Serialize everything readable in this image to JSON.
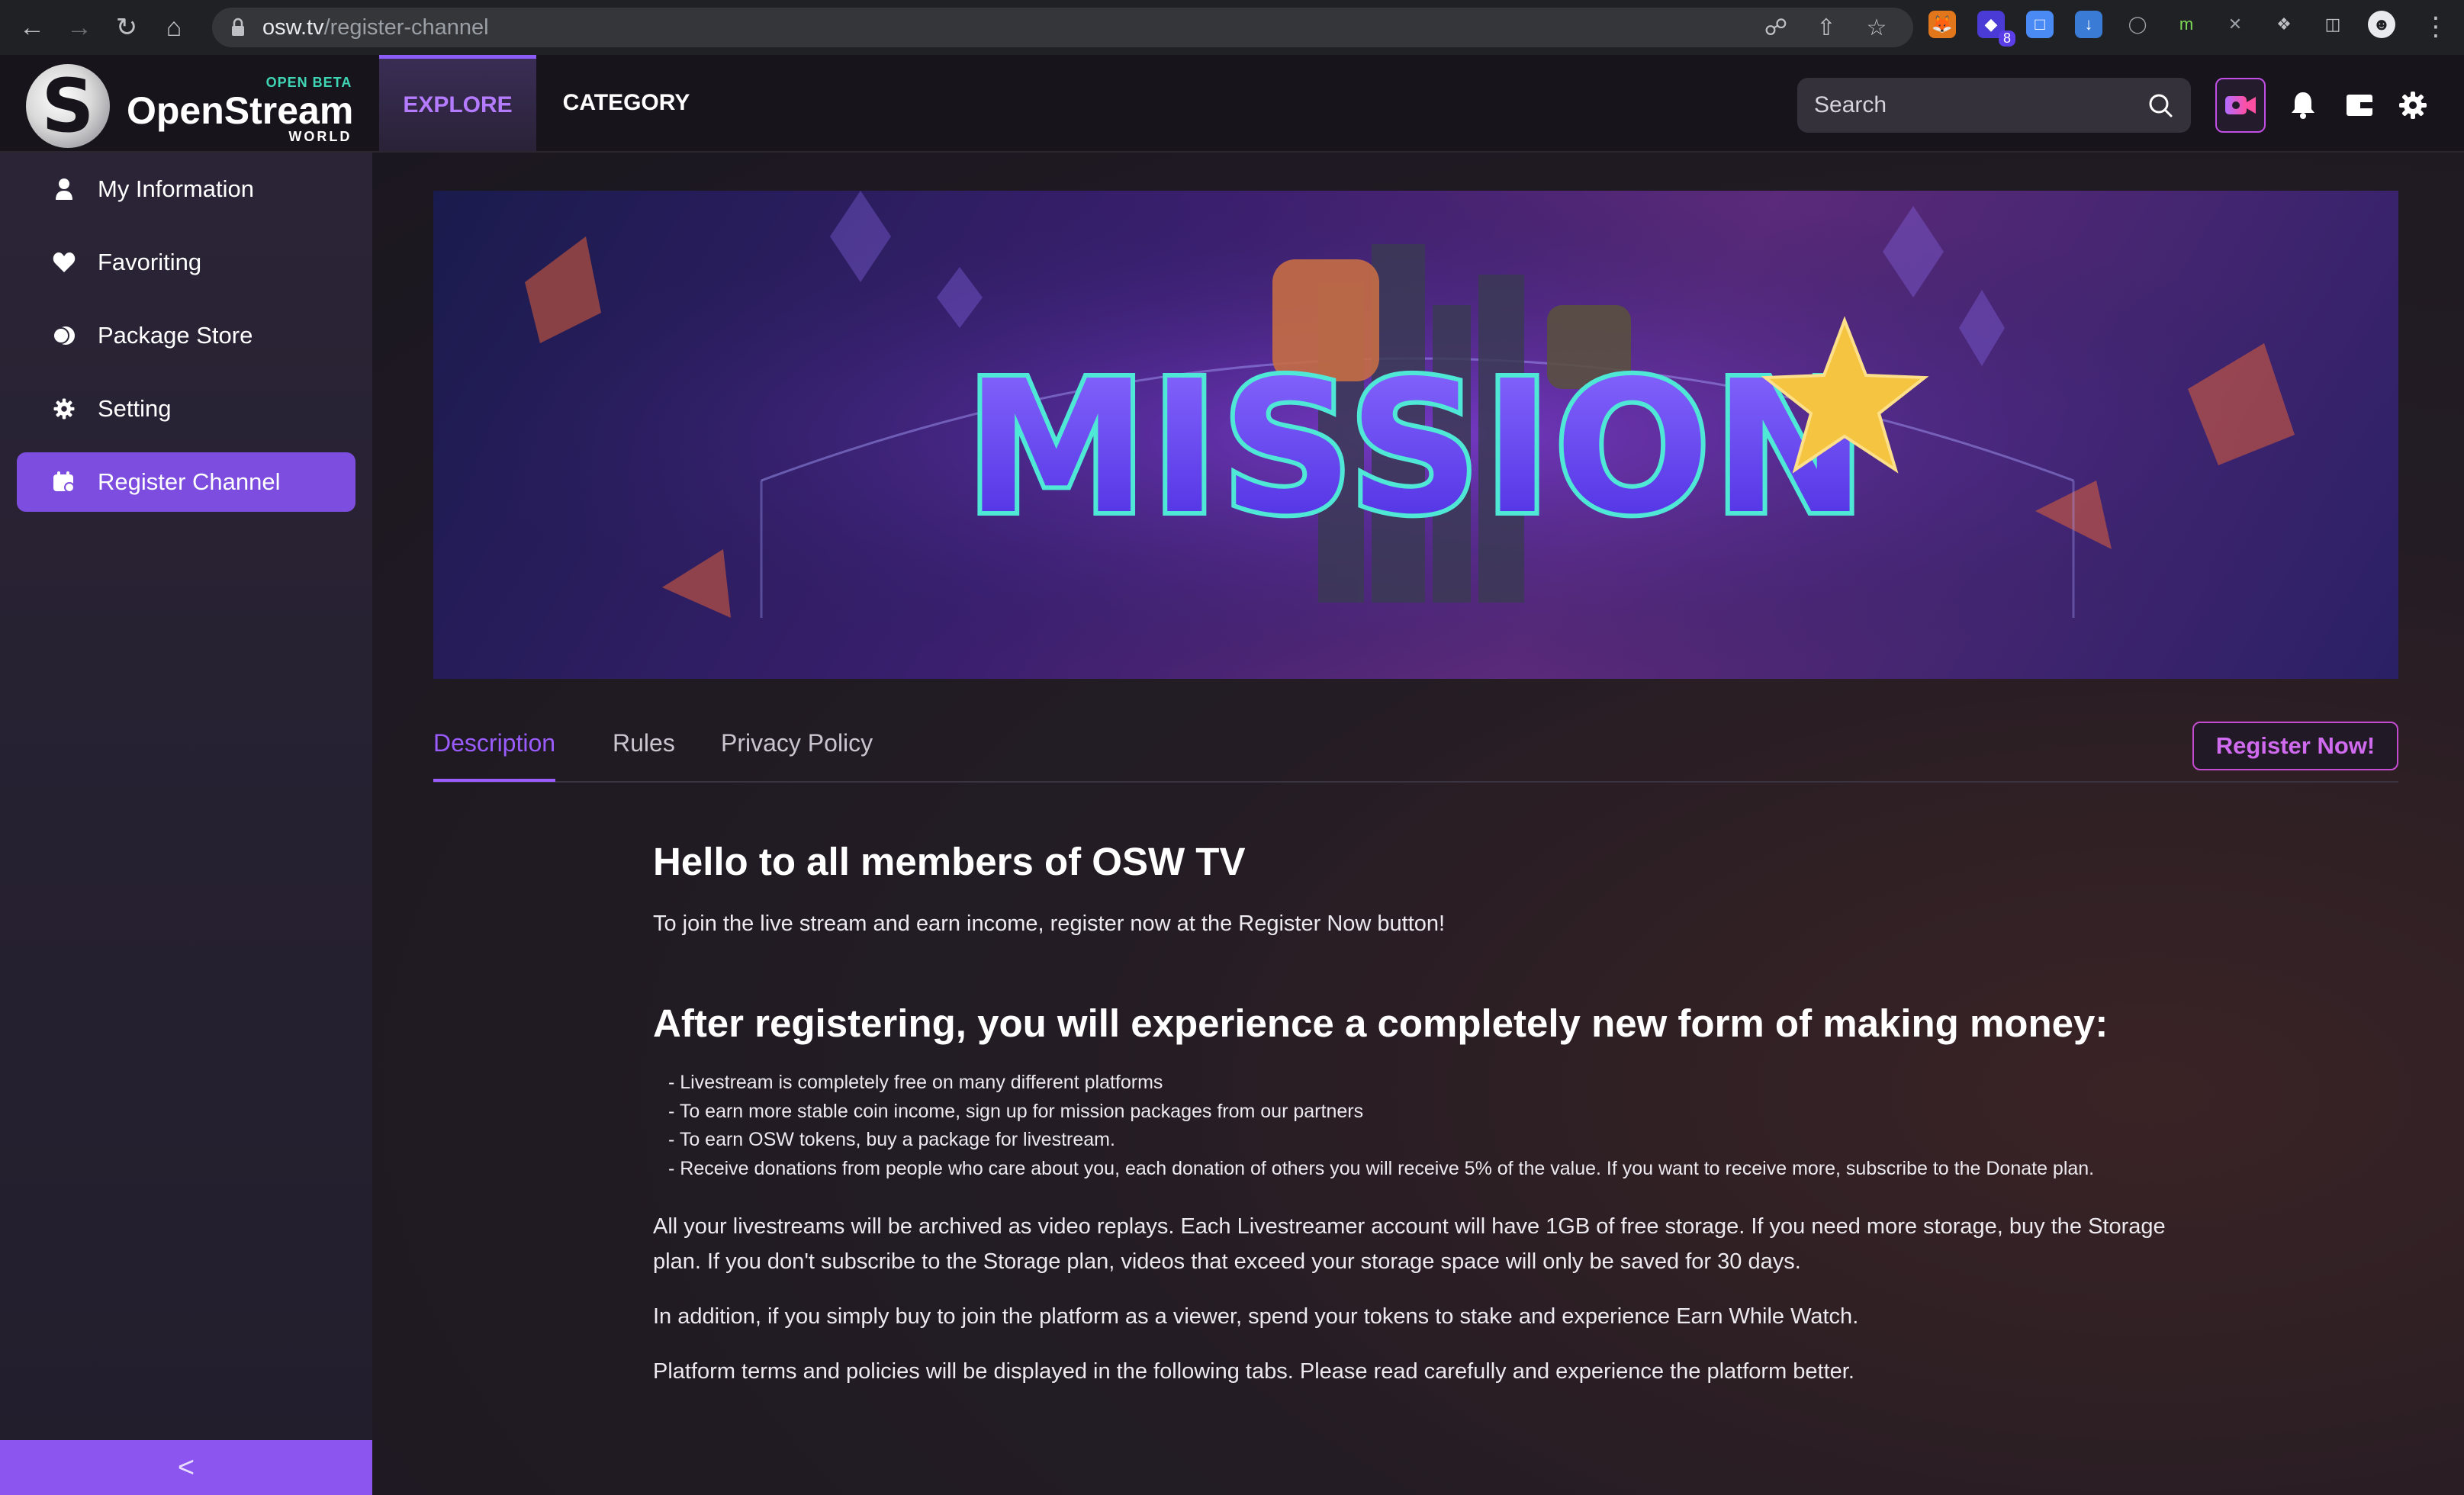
{
  "browser": {
    "url_host": "osw.tv",
    "url_path": "/register-channel",
    "extension_badge": "8"
  },
  "logo": {
    "mark": "S",
    "badge": "OPEN BETA",
    "name": "OpenStream",
    "sub": "WORLD"
  },
  "nav": {
    "explore": "EXPLORE",
    "category": "CATEGORY"
  },
  "search": {
    "placeholder": "Search"
  },
  "sidebar": {
    "items": [
      {
        "label": "My Information",
        "icon": "user-icon"
      },
      {
        "label": "Favoriting",
        "icon": "heart-icon"
      },
      {
        "label": "Package Store",
        "icon": "package-icon"
      },
      {
        "label": "Setting",
        "icon": "gear-icon"
      },
      {
        "label": "Register Channel",
        "icon": "calendar-icon",
        "active": true
      }
    ],
    "collapse": "<"
  },
  "banner": {
    "title": "MISSION"
  },
  "tabs": {
    "description": "Description",
    "rules": "Rules",
    "privacy": "Privacy Policy",
    "register": "Register Now!"
  },
  "content": {
    "heading1": "Hello to all members of OSW TV",
    "lead": "To join the live stream and earn income, register now at the Register Now button!",
    "heading2": "After registering, you will experience a completely new form of making money:",
    "bullets": [
      "- Livestream is completely free on many different platforms",
      "- To earn more stable coin income, sign up for mission packages from our partners",
      "- To earn OSW tokens, buy a package for livestream.",
      "- Receive donations from people who care about you, each donation of others you will receive 5% of the value. If you want to receive more, subscribe to the Donate plan."
    ],
    "paragraphs": [
      "All your livestreams will be archived as video replays. Each Livestreamer account will have 1GB of free storage. If you need more storage, buy the Storage plan. If you don't subscribe to the Storage plan, videos that exceed your storage space will only be saved for 30 days.",
      "In addition, if you simply buy to join the platform as a viewer, spend your tokens to stake and experience Earn While Watch.",
      "Platform terms and policies will be displayed in the following tabs. Please read carefully and experience the platform better."
    ]
  },
  "colors": {
    "accent": "#8b5cf6",
    "register_border": "#c44bd0",
    "sidebar_active": "#7c4dde"
  }
}
